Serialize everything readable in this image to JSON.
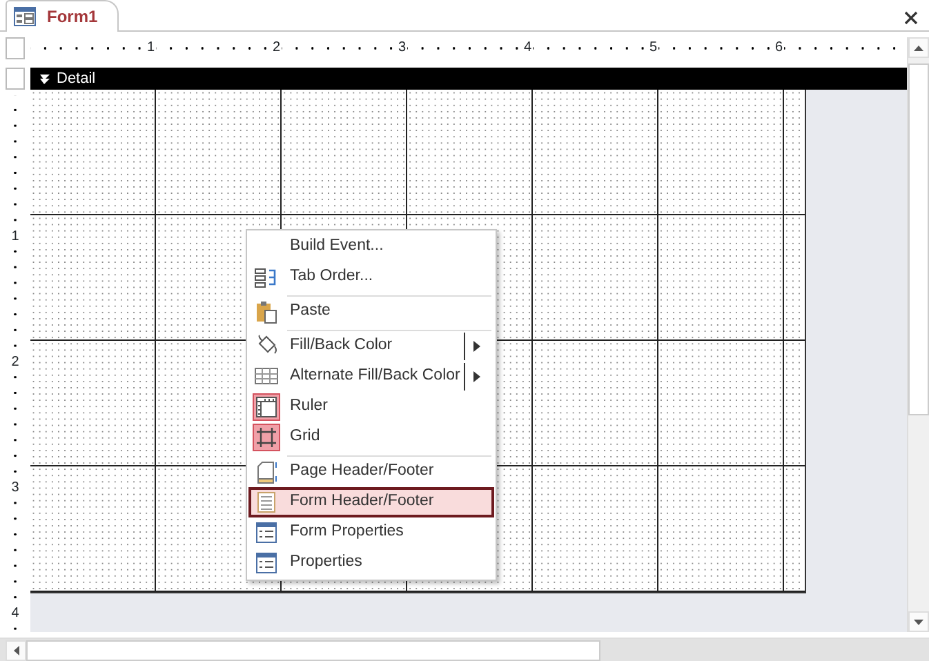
{
  "document_tab": {
    "title": "Form1",
    "selected": true
  },
  "ruler": {
    "horizontal_marks": [
      "1",
      "2",
      "3",
      "4",
      "5",
      "6"
    ],
    "vertical_marks": [
      "1",
      "2",
      "3",
      "4"
    ]
  },
  "section_bar": {
    "title": "Detail"
  },
  "context_menu": {
    "items": [
      {
        "label": "Build Event...",
        "separator_before": false,
        "has_submenu": false,
        "checked": false,
        "selected": false
      },
      {
        "label": "Tab Order...",
        "separator_before": false,
        "has_submenu": false,
        "checked": false,
        "selected": false
      },
      {
        "label": "Paste",
        "separator_before": true,
        "has_submenu": false,
        "checked": false,
        "selected": false
      },
      {
        "label": "Fill/Back Color",
        "separator_before": true,
        "has_submenu": true,
        "checked": false,
        "selected": false
      },
      {
        "label": "Alternate Fill/Back Color",
        "separator_before": false,
        "has_submenu": true,
        "checked": false,
        "selected": false
      },
      {
        "label": "Ruler",
        "separator_before": false,
        "has_submenu": false,
        "checked": true,
        "selected": false
      },
      {
        "label": "Grid",
        "separator_before": false,
        "has_submenu": false,
        "checked": true,
        "selected": false
      },
      {
        "label": "Page Header/Footer",
        "separator_before": true,
        "has_submenu": false,
        "checked": false,
        "selected": false
      },
      {
        "label": "Form Header/Footer",
        "separator_before": false,
        "has_submenu": false,
        "checked": false,
        "selected": true
      },
      {
        "label": "Form Properties",
        "separator_before": false,
        "has_submenu": false,
        "checked": false,
        "selected": false
      },
      {
        "label": "Properties",
        "separator_before": false,
        "has_submenu": false,
        "checked": false,
        "selected": false
      }
    ]
  }
}
